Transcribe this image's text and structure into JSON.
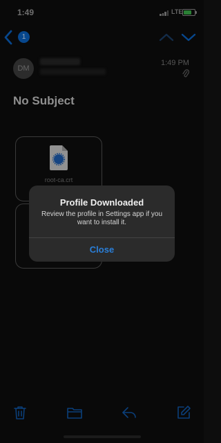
{
  "status": {
    "time": "1:49",
    "carrier_network": "LTE",
    "battery_level": 0.75,
    "battery_color": "#3bb14a"
  },
  "nav": {
    "back_badge_count": "1",
    "back_icon": "chevron-left-icon",
    "prev_icon": "chevron-up-icon",
    "next_icon": "chevron-down-icon",
    "accent_color": "#0b63c4"
  },
  "email": {
    "sender_initials": "DM",
    "time": "1:49 PM",
    "attachment_icon": "paperclip-icon",
    "subject": "No Subject"
  },
  "attachments": [
    {
      "name": "root-ca.crt",
      "icon": "certificate-file-icon"
    },
    {
      "name": "",
      "icon": ""
    }
  ],
  "alert": {
    "title": "Profile Downloaded",
    "message": "Review the profile in Settings app if you want to install it.",
    "button": "Close"
  },
  "toolbar": {
    "icons": [
      "trash-icon",
      "folder-icon",
      "reply-icon",
      "compose-icon"
    ]
  }
}
